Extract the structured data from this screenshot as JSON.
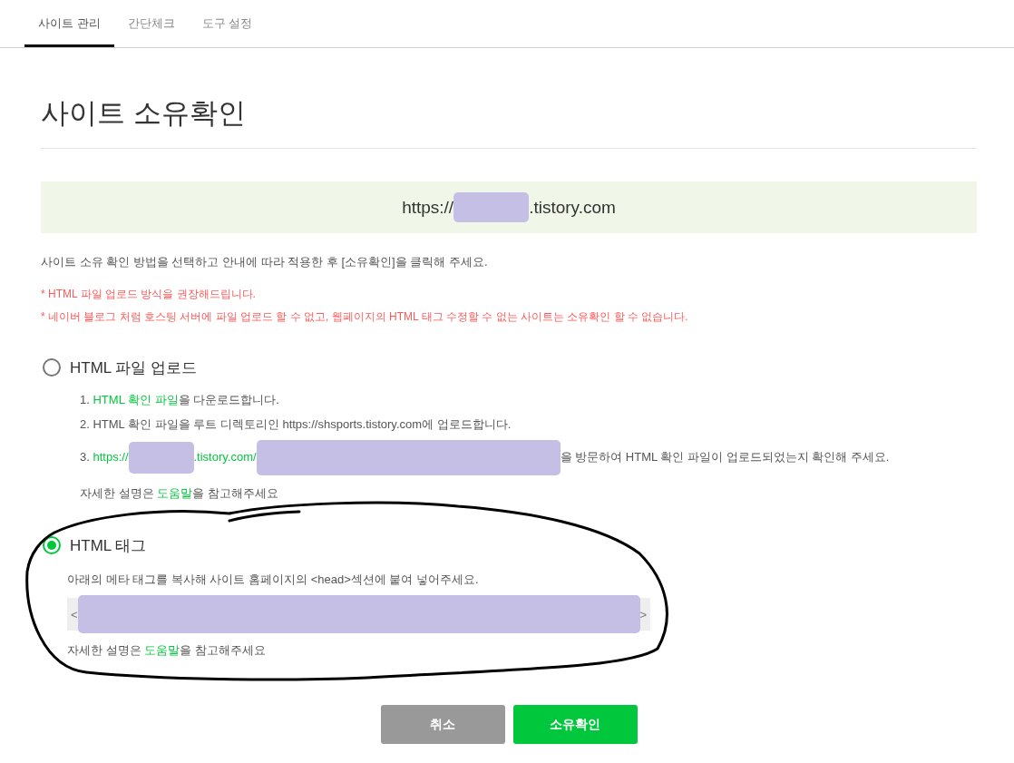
{
  "tabs": [
    {
      "label": "사이트 관리",
      "selected": true
    },
    {
      "label": "간단체크",
      "selected": false
    },
    {
      "label": "도구 설정",
      "selected": false
    }
  ],
  "page": {
    "title": "사이트 소유확인",
    "site_url": [
      {
        "kind": "text",
        "text": "https://"
      },
      {
        "kind": "redaction"
      },
      {
        "kind": "text",
        "text": ".tistory.com"
      }
    ],
    "instruction": "사이트 소유 확인 방법을 선택하고 안내에 따라 적용한 후 [소유확인]을 클릭해 주세요.",
    "warnings": [
      "* HTML 파일 업로드 방식을 권장해드립니다.",
      "* 네이버 블로그 처럼 호스팅 서버에 파일 업로드 할 수 없고, 웹페이지의 HTML 태그 수정할 수 없는 사이트는 소유확인 할 수 없습니다."
    ]
  },
  "methods": [
    {
      "label": "HTML 파일 업로드",
      "selected": false,
      "circled": false,
      "items": [
        {
          "kind": "step",
          "parts": [
            {
              "kind": "text",
              "text": "1. "
            },
            {
              "kind": "link",
              "text": "HTML 확인 파일"
            },
            {
              "kind": "text",
              "text": "을 다운로드합니다."
            }
          ]
        },
        {
          "kind": "step",
          "parts": [
            {
              "kind": "text",
              "text": "2. HTML 확인 파일을 루트 디렉토리인 https://shsports.tistory.com에 업로드합니다."
            }
          ]
        },
        {
          "kind": "step",
          "parts": [
            {
              "kind": "text",
              "text": "3. "
            },
            {
              "kind": "link",
              "text": "https://"
            },
            {
              "kind": "redaction"
            },
            {
              "kind": "link",
              "text": ".tistory.com/"
            },
            {
              "kind": "redaction"
            },
            {
              "kind": "text",
              "text": "을 방문하여 HTML 확인 파일이 업로드되었는지 확인해 주세요."
            }
          ]
        },
        {
          "kind": "help",
          "parts": [
            {
              "kind": "text",
              "text": "자세한 설명은 "
            },
            {
              "kind": "link",
              "text": "도움말"
            },
            {
              "kind": "text",
              "text": "을 참고해주세요"
            }
          ]
        }
      ]
    },
    {
      "label": "HTML 태그",
      "selected": true,
      "circled": true,
      "items": [
        {
          "kind": "note",
          "parts": [
            {
              "kind": "text",
              "text": "아래의 메타 태그를 복사해 사이트 홈페이지의 <head>섹션에 붙여 넣어주세요."
            }
          ]
        },
        {
          "kind": "field",
          "parts": [
            {
              "kind": "text",
              "text": "<"
            },
            {
              "kind": "redaction"
            },
            {
              "kind": "text",
              "text": ">"
            }
          ]
        },
        {
          "kind": "help",
          "parts": [
            {
              "kind": "text",
              "text": "자세한 설명은 "
            },
            {
              "kind": "link",
              "text": "도움말"
            },
            {
              "kind": "text",
              "text": "을 참고해주세요"
            }
          ]
        }
      ]
    }
  ],
  "buttons": [
    {
      "label": "취소",
      "kind": "cancel"
    },
    {
      "label": "소유확인",
      "kind": "confirm"
    }
  ]
}
